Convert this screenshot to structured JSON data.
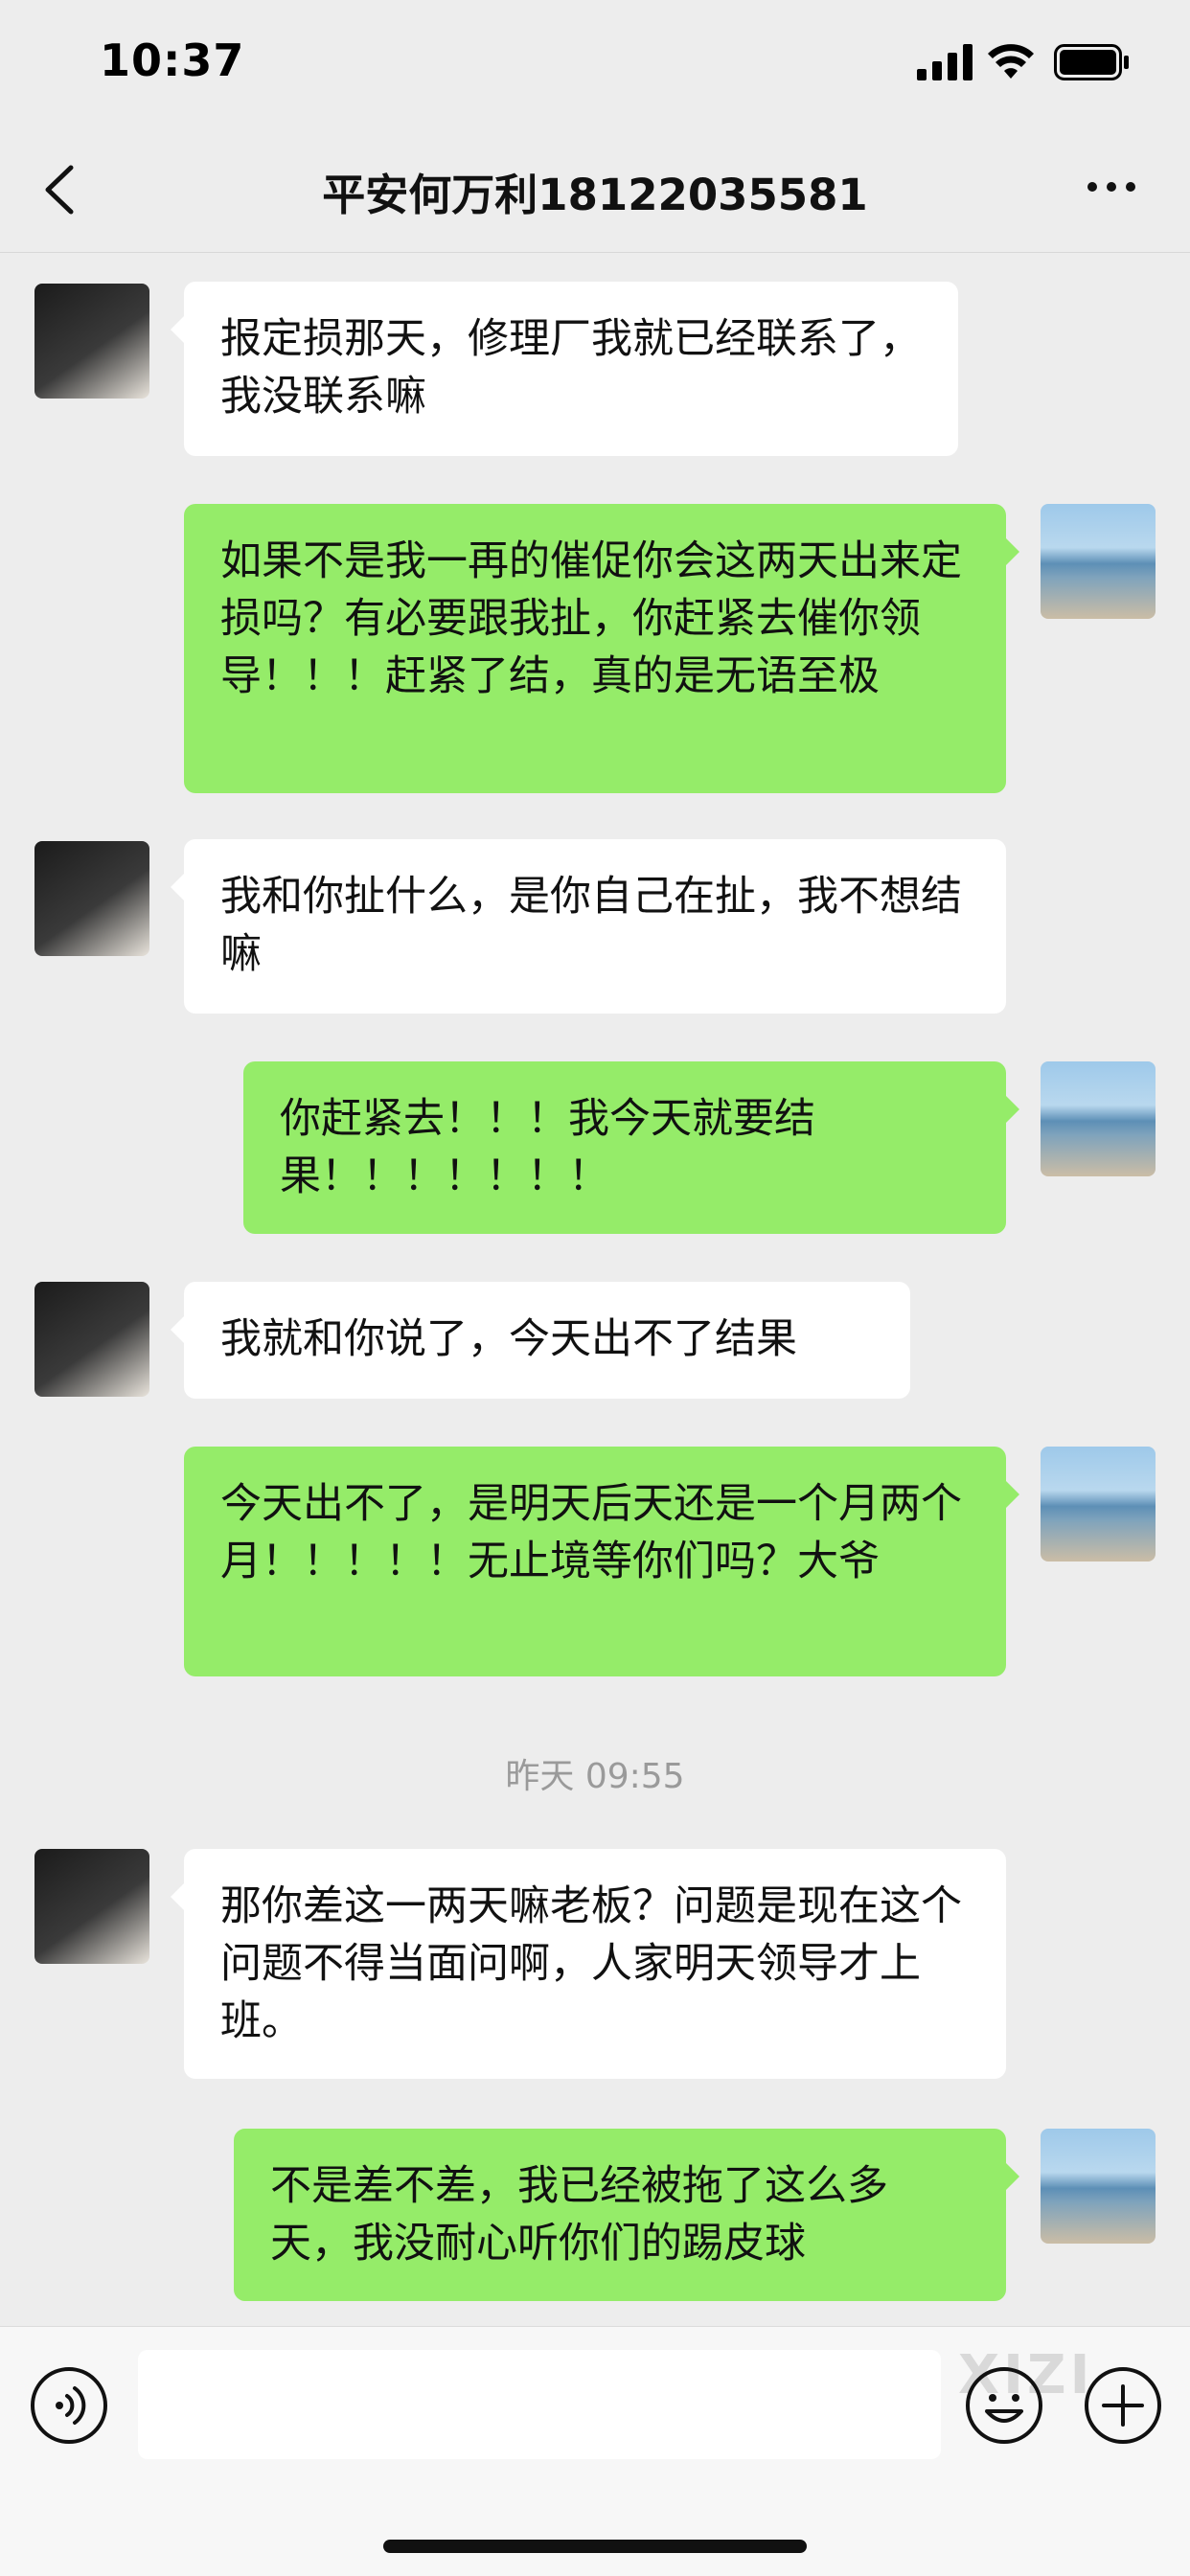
{
  "status_bar": {
    "time": "10:37"
  },
  "header": {
    "title": "平安何万利18122035581"
  },
  "messages": [
    {
      "side": "left",
      "text": "报定损那天，修理厂我就已经联系了，我没联系嘛"
    },
    {
      "side": "right",
      "text": "如果不是我一再的催促你会这两天出来定损吗？有必要跟我扯，你赶紧去催你领导！！！赶紧了结，真的是无语至极"
    },
    {
      "side": "left",
      "text": "我和你扯什么，是你自己在扯，我不想结嘛"
    },
    {
      "side": "right",
      "text": "你赶紧去！！！我今天就要结果！！！！！！！"
    },
    {
      "side": "left",
      "text": "我就和你说了，今天出不了结果"
    },
    {
      "side": "right",
      "text": "今天出不了，是明天后天还是一个月两个月！！！！！无止境等你们吗？大爷"
    },
    {
      "side": "left",
      "text": "那你差这一两天嘛老板？问题是现在这个问题不得当面问啊，人家明天领导才上班。"
    },
    {
      "side": "right",
      "text": "不是差不差，我已经被拖了这么多天，我没耐心听你们的踢皮球"
    }
  ],
  "timestamp": "昨天 09:55",
  "input_bar": {
    "value": "",
    "watermark": "XIZI"
  },
  "icons": {
    "back": "chevron-left-icon",
    "more": "more-dots-icon",
    "voice": "voice-icon",
    "emoji": "emoji-icon",
    "plus": "plus-icon"
  },
  "colors": {
    "background": "#ededed",
    "bubble_self": "#95ec69",
    "bubble_other": "#ffffff"
  }
}
